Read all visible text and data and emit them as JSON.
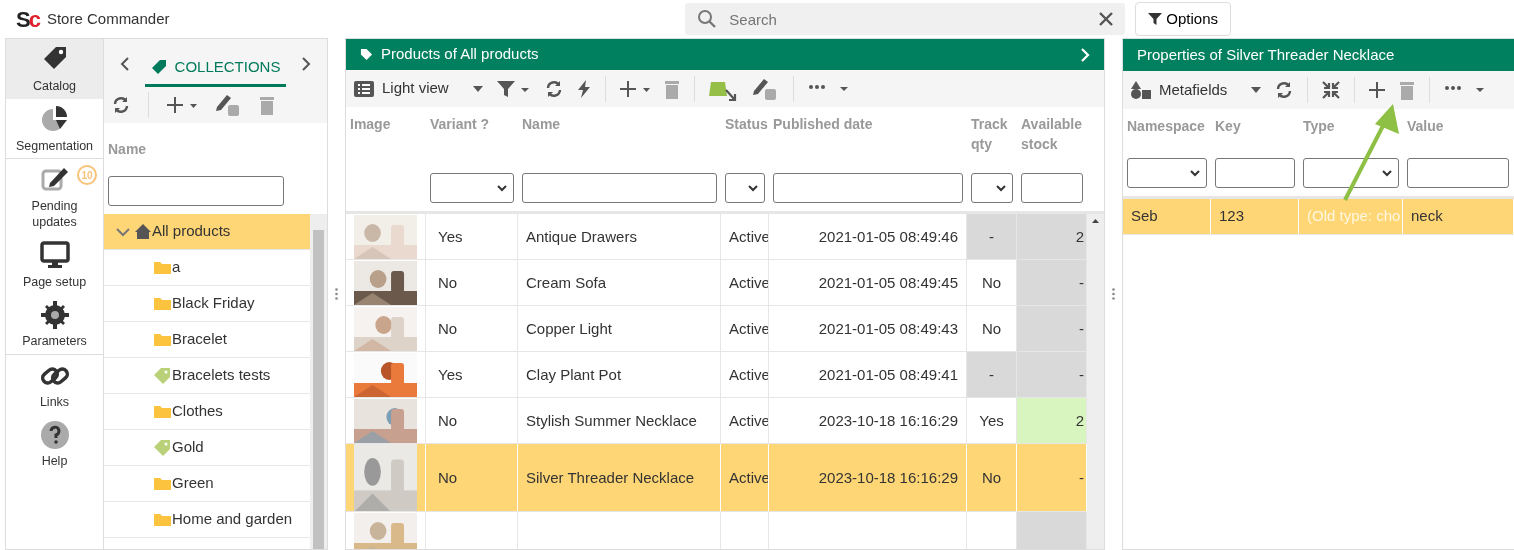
{
  "app": {
    "logo": "Sc",
    "title": "Store Commander"
  },
  "search": {
    "placeholder": "Search"
  },
  "options_button": "Options",
  "rail": [
    {
      "label": "Catalog",
      "kind": "tag",
      "selected": true
    },
    {
      "label": "Segmentation",
      "kind": "pie",
      "selected": false
    },
    {
      "label": "Pending updates",
      "kind": "edit",
      "badge": "10",
      "selected": false
    },
    {
      "label": "Page setup",
      "kind": "monitor",
      "selected": false
    },
    {
      "label": "Parameters",
      "kind": "gear",
      "selected": false
    },
    {
      "label": "Links",
      "kind": "link",
      "selected": false
    },
    {
      "label": "Help",
      "kind": "help",
      "selected": false
    }
  ],
  "collections": {
    "tab": "COLLECTIONS",
    "column": "Name",
    "tree": [
      {
        "label": "All products",
        "kind": "home",
        "expanded": true,
        "selected": true,
        "children": [
          {
            "label": "a",
            "kind": "folder",
            "selected": false
          },
          {
            "label": "Black Friday",
            "kind": "folder",
            "selected": false
          },
          {
            "label": "Bracelet",
            "kind": "folder",
            "selected": false
          },
          {
            "label": "Bracelets tests",
            "kind": "smart",
            "selected": false
          },
          {
            "label": "Clothes",
            "kind": "folder",
            "selected": false
          },
          {
            "label": "Gold",
            "kind": "smart",
            "selected": false
          },
          {
            "label": "Green",
            "kind": "folder",
            "selected": false
          },
          {
            "label": "Home and garden",
            "kind": "folder",
            "selected": false
          }
        ]
      }
    ]
  },
  "products": {
    "title": "Products of All products",
    "view": "Light view",
    "columns": [
      {
        "label": "Image"
      },
      {
        "label": "Variant ?",
        "kind": "select"
      },
      {
        "label": "Name",
        "kind": "text"
      },
      {
        "label": "Status",
        "kind": "select"
      },
      {
        "label": "Published date",
        "kind": "text"
      },
      {
        "label": "Track qty",
        "kind": "select"
      },
      {
        "label": "Available stock",
        "kind": "text"
      }
    ],
    "rows": [
      {
        "variant": "Yes",
        "name": "Antique Drawers",
        "status": "Active",
        "date": "2021-01-05 08:49:46",
        "track": "-",
        "track_cell": {
          "color": "#d9d9d9"
        },
        "stock": "2",
        "stock_cell": {
          "color": "#d9d9d9"
        },
        "selected": false
      },
      {
        "variant": "No",
        "name": "Cream Sofa",
        "status": "Active",
        "date": "2021-01-05 08:49:45",
        "track": "No",
        "stock": "-",
        "stock_cell": {
          "color": "#d9d9d9"
        },
        "selected": false
      },
      {
        "variant": "No",
        "name": "Copper Light",
        "status": "Active",
        "date": "2021-01-05 08:49:43",
        "track": "No",
        "stock": "-",
        "stock_cell": {
          "color": "#d9d9d9"
        },
        "selected": false
      },
      {
        "variant": "Yes",
        "name": "Clay Plant Pot",
        "status": "Active",
        "date": "2021-01-05 08:49:41",
        "track": "-",
        "track_cell": {
          "color": "#d9d9d9"
        },
        "stock": "-",
        "stock_cell": {
          "color": "#d9d9d9"
        },
        "selected": false
      },
      {
        "variant": "No",
        "name": "Stylish Summer Necklace",
        "status": "Active",
        "date": "2023-10-18 16:16:29",
        "track": "Yes",
        "stock": "2",
        "stock_cell": {
          "color": "#d8f5c0"
        },
        "selected": false
      },
      {
        "variant": "No",
        "name": "Silver Threader Necklace",
        "status": "Active",
        "date": "2023-10-18 16:16:29",
        "track": "No",
        "stock": "-",
        "selected": true
      },
      {
        "stock_cell": {
          "color": "#d9d9d9"
        },
        "selected": false
      }
    ]
  },
  "properties": {
    "title": "Properties of Silver Threader Necklace",
    "view": "Metafields",
    "columns": [
      {
        "label": "Namespace",
        "kind": "select"
      },
      {
        "label": "Key",
        "kind": "text"
      },
      {
        "label": "Type",
        "kind": "select"
      },
      {
        "label": "Value",
        "kind": "text"
      }
    ],
    "rows": [
      {
        "namespace": "Seb",
        "key": "123",
        "type": "(Old type: cho",
        "value": "neck",
        "selected": true
      }
    ]
  }
}
